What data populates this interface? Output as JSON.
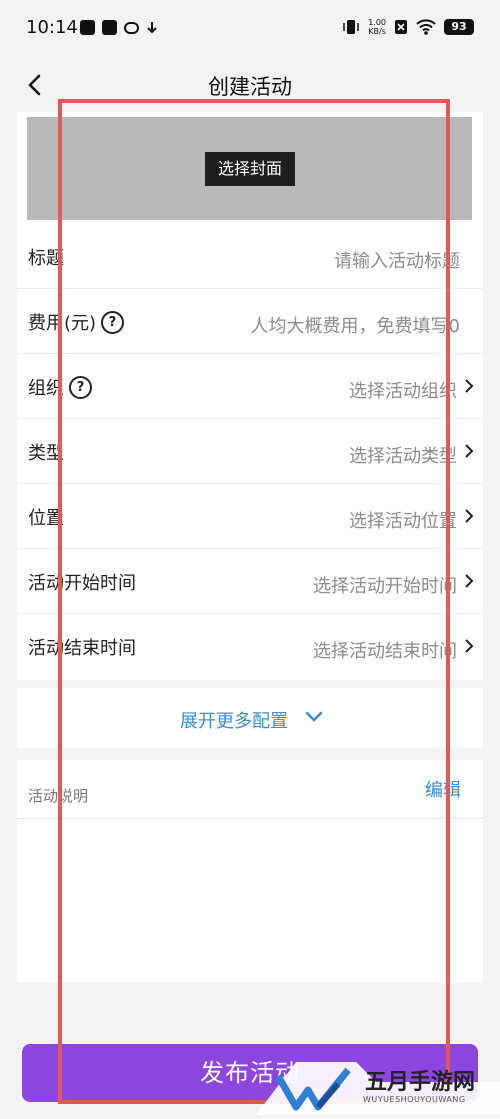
{
  "status_bar": {
    "time": "10:14",
    "net_speed_value": "1.00",
    "net_speed_unit": "KB/s",
    "battery": "93"
  },
  "nav": {
    "title": "创建活动"
  },
  "cover": {
    "button_label": "选择封面"
  },
  "form": {
    "rows": [
      {
        "label": "标题",
        "value": "请输入活动标题"
      },
      {
        "label": "费用(元)",
        "value": "人均大概费用，免费填写0"
      },
      {
        "label": "组织",
        "value": "选择活动组织"
      },
      {
        "label": "类型",
        "value": "选择活动类型"
      },
      {
        "label": "位置",
        "value": "选择活动位置"
      },
      {
        "label": "活动开始时间",
        "value": "选择活动开始时间"
      },
      {
        "label": "活动结束时间",
        "value": "选择活动结束时间"
      }
    ]
  },
  "expand": {
    "label": "展开更多配置"
  },
  "description": {
    "label": "活动说明",
    "edit": "编辑"
  },
  "publish": {
    "label": "发布活动"
  },
  "watermark": {
    "name": "五月手游网",
    "sub": "WUYUESHOUYOUWANG"
  },
  "colors": {
    "accent": "#3c8fd2",
    "publish": "#8d47e0",
    "highlight": "#e05a5a"
  }
}
